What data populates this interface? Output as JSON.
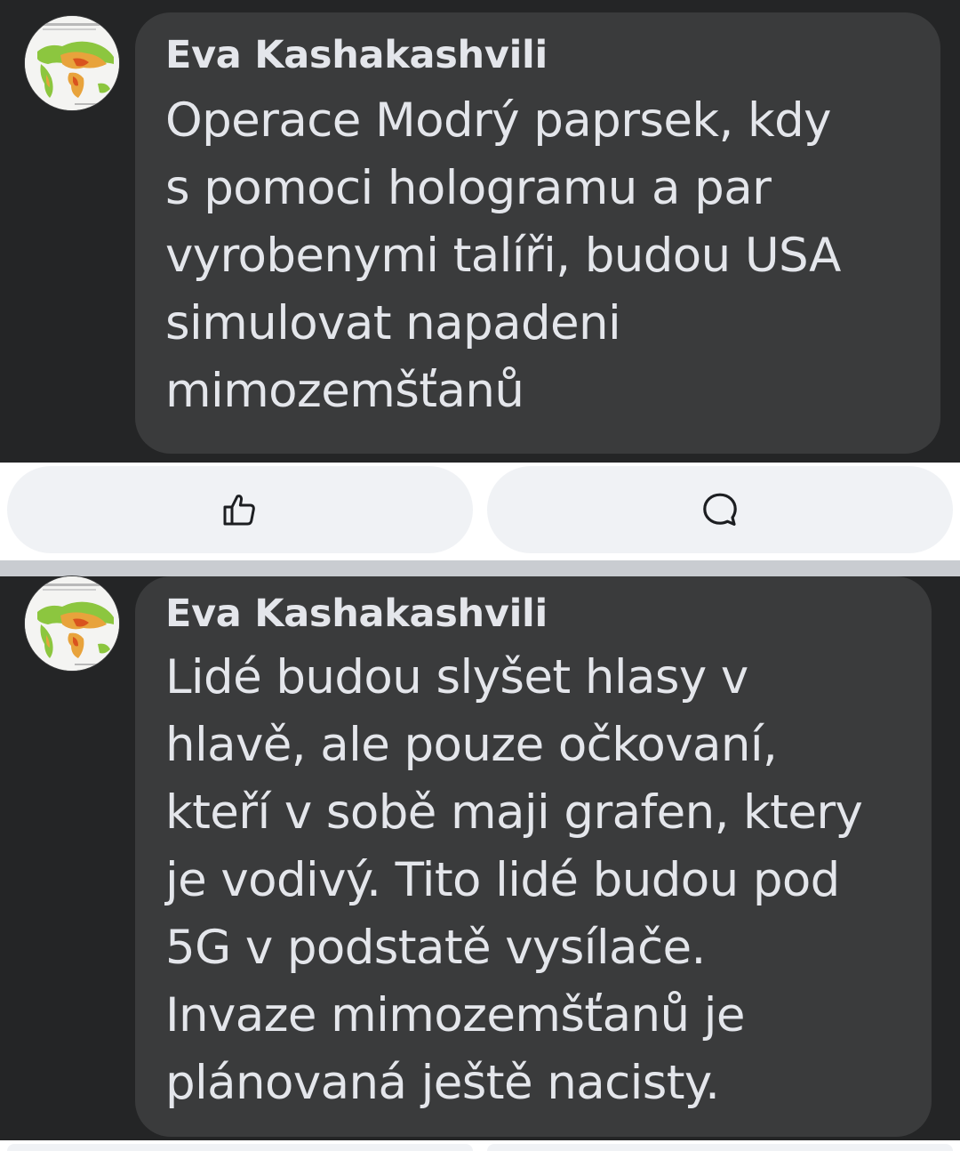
{
  "comments": [
    {
      "author": "Eva Kashakashvili",
      "lines": [
        "Operace Modrý paprsek, kdy",
        "s pomoci hologramu a par",
        "vyrobenymi talíři, budou USA",
        "simulovat napadeni",
        "mimozemšťanů"
      ]
    },
    {
      "author": "Eva Kashakashvili",
      "lines": [
        "Lidé budou slyšet hlasy v",
        "hlavě, ale pouze očkovaní,",
        "kteří v sobě maji grafen, ktery",
        "je vodivý. Tito lidé budou pod",
        "5G v podstatě vysílače.",
        "Invaze mimozemšťanů je",
        "plánovaná ještě nacisty."
      ]
    }
  ],
  "actions": {
    "like_icon": "thumbs-up-icon",
    "comment_icon": "speech-bubble-icon"
  },
  "colors": {
    "dark_background": "#242526",
    "bubble": "#3a3b3c",
    "text": "#e4e6eb",
    "action_bar": "#ffffff",
    "action_pill": "#f0f2f5",
    "divider": "#c9ccd1",
    "icon": "#1c1e21"
  }
}
